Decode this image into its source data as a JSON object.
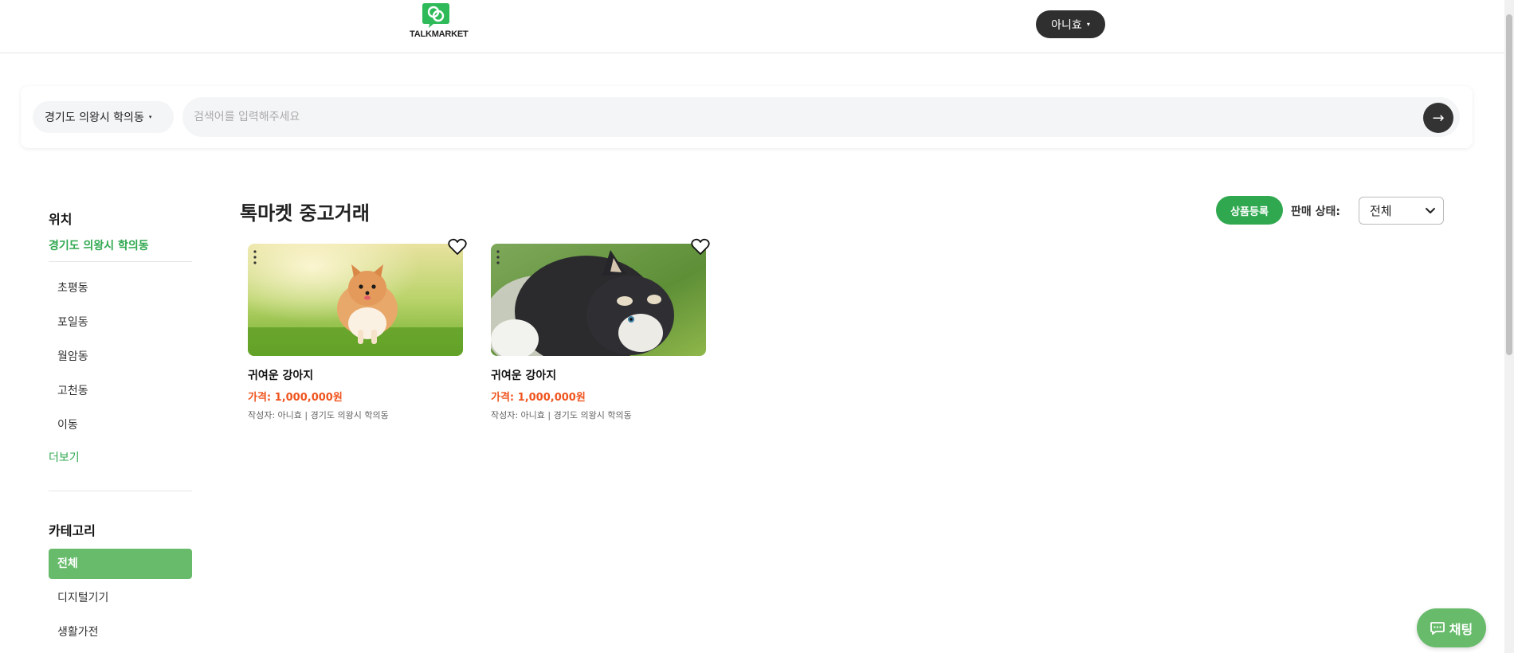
{
  "header": {
    "logo_text": "TALKMARKET",
    "user_label": "아니효",
    "user_caret": "▾"
  },
  "search": {
    "location_label": "경기도 의왕시 학의동",
    "location_caret": "▾",
    "placeholder": "검색어를 입력해주세요",
    "value": "",
    "submit_icon": "→"
  },
  "sidebar": {
    "location_heading": "위치",
    "current_location": "경기도 의왕시 학의동",
    "dong_items": [
      "초평동",
      "포일동",
      "월암동",
      "고천동",
      "이동"
    ],
    "more_label": "더보기",
    "category_heading": "카테고리",
    "categories": [
      "전체",
      "디지털기기",
      "생활가전"
    ],
    "active_category": "전체"
  },
  "main": {
    "title": "톡마켓 중고거래",
    "register_label": "상품등록",
    "status_label": "판매 상태:",
    "status_value": "전체"
  },
  "products": [
    {
      "title": "귀여운 강아지",
      "price": "가격: 1,000,000원",
      "meta": "작성자: 아니효 | 경기도 의왕시 학의동",
      "image": "pomeranian-photo"
    },
    {
      "title": "귀여운 강아지",
      "price": "가격: 1,000,000원",
      "meta": "작성자: 아니효 | 경기도 의왕시 학의동",
      "image": "husky-puppy-photo"
    }
  ],
  "chat": {
    "label": "채팅",
    "icon": "chat-bubble-icon"
  },
  "colors": {
    "brand_green": "#2fa84f",
    "soft_green": "#67bb6b",
    "price_orange": "#f0541e",
    "dark": "#2f2f2f"
  }
}
